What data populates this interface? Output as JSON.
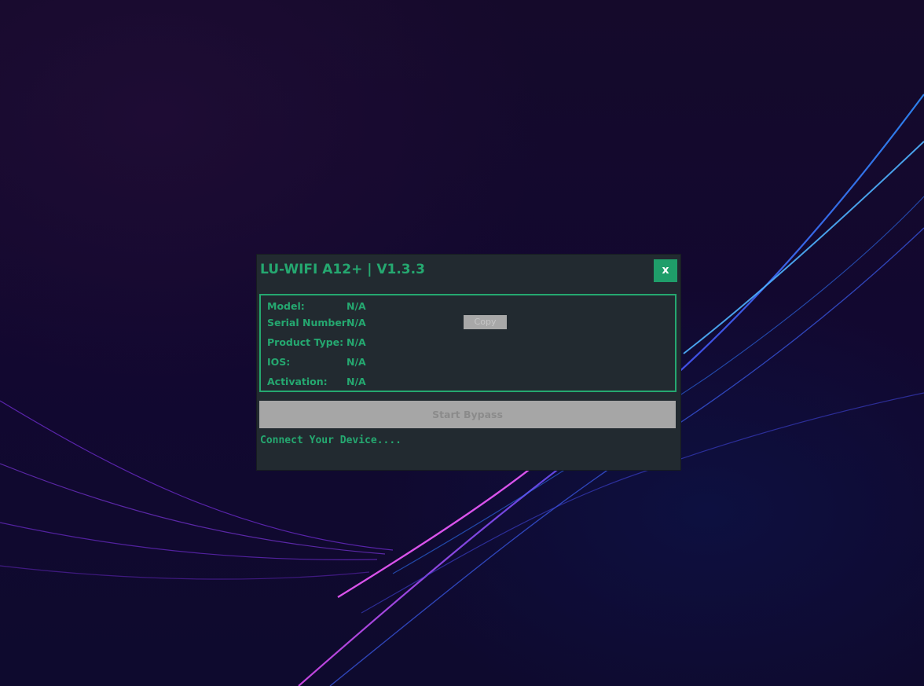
{
  "window": {
    "title": "LU-WIFI A12+ | V1.3.3",
    "close_label": "x"
  },
  "device_info": {
    "rows": [
      {
        "label": "Model:",
        "value": "N/A"
      },
      {
        "label": "Serial Number:",
        "value": "N/A"
      },
      {
        "label": "Product Type:",
        "value": "N/A"
      },
      {
        "label": "IOS:",
        "value": "N/A"
      },
      {
        "label": "Activation:",
        "value": "N/A"
      }
    ],
    "copy_label": "Copy"
  },
  "actions": {
    "start_bypass_label": "Start Bypass"
  },
  "status": {
    "message": "Connect Your Device...."
  },
  "colors": {
    "accent": "#25a870",
    "window_bg": "#222a30",
    "disabled_button": "#a6a6a6"
  }
}
